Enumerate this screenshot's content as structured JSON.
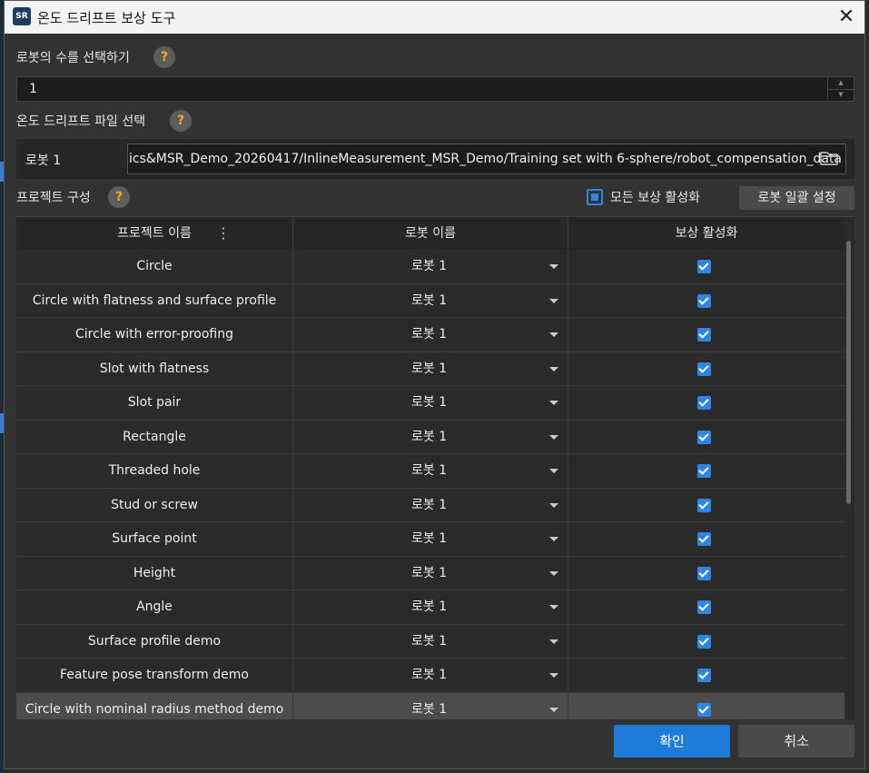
{
  "window": {
    "title": "온도 드리프트 보상 도구",
    "icon_text": "SR"
  },
  "robot_count": {
    "label": "로봇의 수를 선택하기",
    "value": "1"
  },
  "drift_file": {
    "label": "온도 드리프트 파일 선택",
    "robot_label": "로봇 1",
    "path": "ics&MSR_Demo_20260417/InlineMeasurement_MSR_Demo/Training set with 6-sphere/robot_compensation_data"
  },
  "project_config": {
    "label": "프로젝트 구성",
    "enable_all_label": "모든 보상 활성화",
    "batch_button": "로봇 일괄 설정"
  },
  "table": {
    "headers": [
      "프로젝트 이름",
      "로봇 이름",
      "보상 활성화"
    ],
    "rows": [
      {
        "project": "Circle",
        "robot": "로봇 1",
        "enabled": true
      },
      {
        "project": "Circle with flatness and surface profile",
        "robot": "로봇 1",
        "enabled": true
      },
      {
        "project": "Circle with error-proofing",
        "robot": "로봇 1",
        "enabled": true
      },
      {
        "project": "Slot with flatness",
        "robot": "로봇 1",
        "enabled": true
      },
      {
        "project": "Slot pair",
        "robot": "로봇 1",
        "enabled": true
      },
      {
        "project": "Rectangle",
        "robot": "로봇 1",
        "enabled": true
      },
      {
        "project": "Threaded hole",
        "robot": "로봇 1",
        "enabled": true
      },
      {
        "project": "Stud or screw",
        "robot": "로봇 1",
        "enabled": true
      },
      {
        "project": "Surface point",
        "robot": "로봇 1",
        "enabled": true
      },
      {
        "project": "Height",
        "robot": "로봇 1",
        "enabled": true
      },
      {
        "project": "Angle",
        "robot": "로봇 1",
        "enabled": true
      },
      {
        "project": "Surface profile demo",
        "robot": "로봇 1",
        "enabled": true
      },
      {
        "project": "Feature pose transform demo",
        "robot": "로봇 1",
        "enabled": true
      },
      {
        "project": "Circle with nominal radius method demo",
        "robot": "로봇 1",
        "enabled": true,
        "selected": true
      }
    ]
  },
  "buttons": {
    "ok": "확인",
    "cancel": "취소"
  },
  "colors": {
    "accent": "#1e7bd7",
    "checkbox": "#2f86e0"
  }
}
